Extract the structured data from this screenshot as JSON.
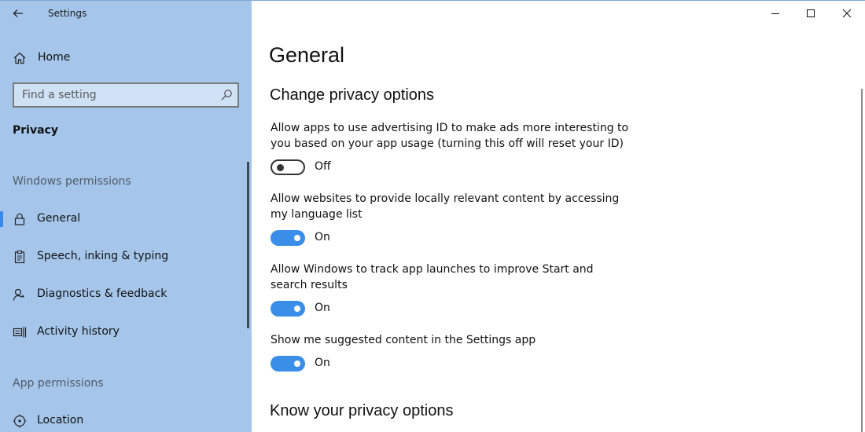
{
  "app": {
    "title": "Settings"
  },
  "sidebar": {
    "home_label": "Home",
    "search_placeholder": "Find a setting",
    "section_title": "Privacy",
    "windows_permissions_label": "Windows permissions",
    "items": [
      {
        "label": "General",
        "icon": "lock-icon",
        "selected": true
      },
      {
        "label": "Speech, inking & typing",
        "icon": "clipboard-icon",
        "selected": false
      },
      {
        "label": "Diagnostics & feedback",
        "icon": "person-feedback-icon",
        "selected": false
      },
      {
        "label": "Activity history",
        "icon": "activity-history-icon",
        "selected": false
      }
    ],
    "app_permissions_label": "App permissions",
    "app_items": [
      {
        "label": "Location",
        "icon": "location-icon"
      }
    ]
  },
  "main": {
    "title": "General",
    "section1_title": "Change privacy options",
    "settings": [
      {
        "description": "Allow apps to use advertising ID to make ads more interesting to you based on your app usage (turning this off will reset your ID)",
        "state": "Off"
      },
      {
        "description": "Allow websites to provide locally relevant content by accessing my language list",
        "state": "On"
      },
      {
        "description": "Allow Windows to track app launches to improve Start and search results",
        "state": "On"
      },
      {
        "description": "Show me suggested content in the Settings app",
        "state": "On"
      }
    ],
    "section2_title": "Know your privacy options"
  },
  "colors": {
    "sidebar_bg": "#a5c6ea",
    "accent": "#3b8ee8"
  }
}
